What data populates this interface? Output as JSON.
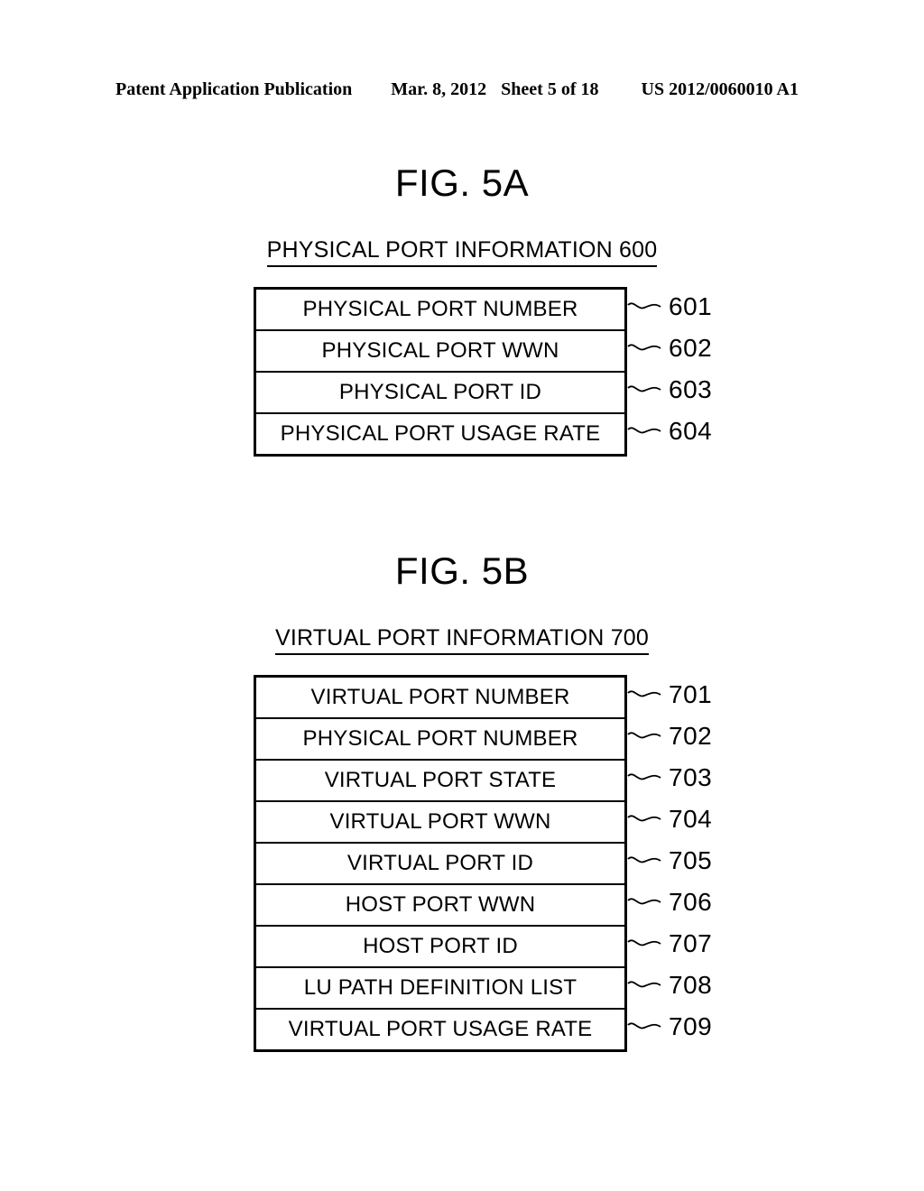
{
  "header": {
    "publication": "Patent Application Publication",
    "date": "Mar. 8, 2012",
    "sheet": "Sheet 5 of 18",
    "doc_number": "US 2012/0060010 A1"
  },
  "figures": [
    {
      "label": "FIG. 5A",
      "caption": "PHYSICAL PORT INFORMATION 600",
      "rows": [
        {
          "label": "PHYSICAL PORT NUMBER",
          "ref": "601"
        },
        {
          "label": "PHYSICAL PORT WWN",
          "ref": "602"
        },
        {
          "label": "PHYSICAL PORT ID",
          "ref": "603"
        },
        {
          "label": "PHYSICAL PORT USAGE RATE",
          "ref": "604"
        }
      ]
    },
    {
      "label": "FIG. 5B",
      "caption": "VIRTUAL PORT INFORMATION 700",
      "rows": [
        {
          "label": "VIRTUAL PORT NUMBER",
          "ref": "701"
        },
        {
          "label": "PHYSICAL PORT NUMBER",
          "ref": "702"
        },
        {
          "label": "VIRTUAL PORT STATE",
          "ref": "703"
        },
        {
          "label": "VIRTUAL PORT WWN",
          "ref": "704"
        },
        {
          "label": "VIRTUAL PORT ID",
          "ref": "705"
        },
        {
          "label": "HOST PORT WWN",
          "ref": "706"
        },
        {
          "label": "HOST PORT ID",
          "ref": "707"
        },
        {
          "label": "LU PATH DEFINITION LIST",
          "ref": "708"
        },
        {
          "label": "VIRTUAL PORT USAGE RATE",
          "ref": "709"
        }
      ]
    }
  ],
  "colors": {
    "ink": "#000000",
    "paper": "#ffffff"
  }
}
